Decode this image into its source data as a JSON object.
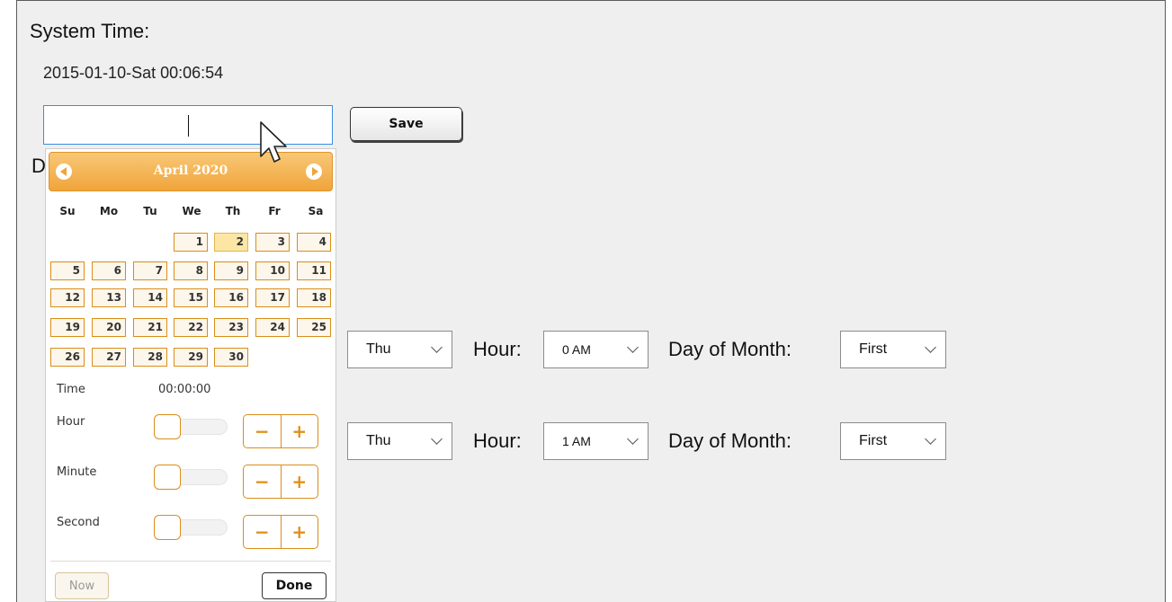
{
  "system_time": {
    "title": "System Time:",
    "current": "2015-01-10-Sat 00:06:54",
    "input_value": "",
    "save_label": "Save",
    "hidden_heading_letter": "D"
  },
  "datepicker": {
    "month_label": "April 2020",
    "weekdays": [
      "Su",
      "Mo",
      "Tu",
      "We",
      "Th",
      "Fr",
      "Sa"
    ],
    "days": [
      "1",
      "2",
      "3",
      "4",
      "5",
      "6",
      "7",
      "8",
      "9",
      "10",
      "11",
      "12",
      "13",
      "14",
      "15",
      "16",
      "17",
      "18",
      "19",
      "20",
      "21",
      "22",
      "23",
      "24",
      "25",
      "26",
      "27",
      "28",
      "29",
      "30"
    ],
    "today": "2",
    "time_label": "Time",
    "time_value": "00:00:00",
    "hour_label": "Hour",
    "minute_label": "Minute",
    "second_label": "Second",
    "minus": "−",
    "plus": "+",
    "now_label": "Now",
    "done_label": "Done",
    "accent": "#f0a43a"
  },
  "schedule_rows": [
    {
      "weekday": "Thu",
      "hour_label": "Hour:",
      "hour": "0 AM",
      "dom_label": "Day of Month:",
      "dom": "First"
    },
    {
      "weekday": "Thu",
      "hour_label": "Hour:",
      "hour": "1 AM",
      "dom_label": "Day of Month:",
      "dom": "First"
    }
  ]
}
